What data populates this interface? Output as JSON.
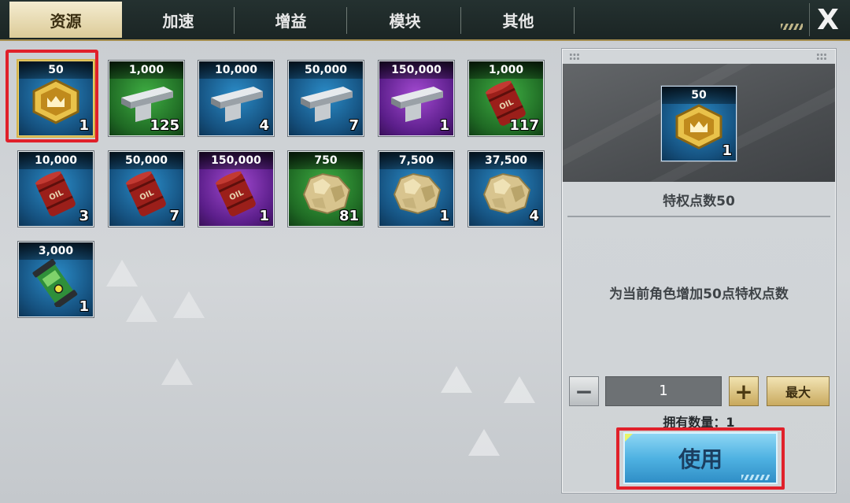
{
  "tabs": [
    {
      "label": "资源",
      "active": true
    },
    {
      "label": "加速"
    },
    {
      "label": "增益"
    },
    {
      "label": "模块"
    },
    {
      "label": "其他"
    }
  ],
  "close_label": "X",
  "items": [
    {
      "amount": "50",
      "count": "1",
      "kind": "privilege-badge",
      "rarity": "blue",
      "selected": true
    },
    {
      "amount": "1,000",
      "count": "125",
      "kind": "steel",
      "rarity": "green"
    },
    {
      "amount": "10,000",
      "count": "4",
      "kind": "steel",
      "rarity": "blue"
    },
    {
      "amount": "50,000",
      "count": "7",
      "kind": "steel",
      "rarity": "blue"
    },
    {
      "amount": "150,000",
      "count": "1",
      "kind": "steel",
      "rarity": "purple"
    },
    {
      "amount": "1,000",
      "count": "117",
      "kind": "oil",
      "rarity": "green"
    },
    {
      "amount": "10,000",
      "count": "3",
      "kind": "oil",
      "rarity": "blue"
    },
    {
      "amount": "50,000",
      "count": "7",
      "kind": "oil",
      "rarity": "blue"
    },
    {
      "amount": "150,000",
      "count": "1",
      "kind": "oil",
      "rarity": "purple"
    },
    {
      "amount": "750",
      "count": "81",
      "kind": "ore",
      "rarity": "green"
    },
    {
      "amount": "7,500",
      "count": "1",
      "kind": "ore",
      "rarity": "blue"
    },
    {
      "amount": "37,500",
      "count": "4",
      "kind": "ore",
      "rarity": "blue"
    },
    {
      "amount": "3,000",
      "count": "1",
      "kind": "uranium",
      "rarity": "blue"
    }
  ],
  "detail": {
    "preview_amount": "50",
    "preview_count": "1",
    "name": "特权点数50",
    "description": "为当前角色增加50点特权点数",
    "quantity": "1",
    "minus_label": "−",
    "plus_label": "+",
    "max_label": "最大",
    "owned_label": "拥有数量：1",
    "use_label": "使用"
  },
  "oil_text": "OIL",
  "colors": {
    "accent_gold": "#a48c4d",
    "highlight_red": "#e0202a",
    "use_button_blue": "#4fb2e2"
  }
}
